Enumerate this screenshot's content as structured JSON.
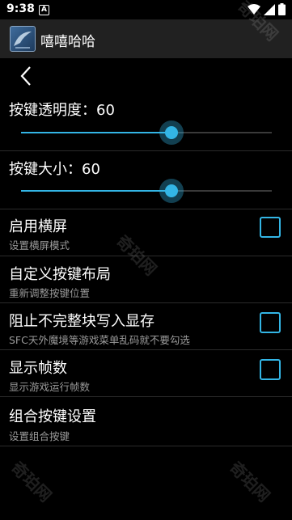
{
  "status_bar": {
    "time": "9:38",
    "notification_icon_letter": "A"
  },
  "app_bar": {
    "title": "嘻嘻哈哈",
    "icon": "app-logo-icon"
  },
  "sliders": [
    {
      "label": "按键透明度：60",
      "value": 60,
      "max": 100
    },
    {
      "label": "按键大小：60",
      "value": 60,
      "max": 100
    }
  ],
  "settings": [
    {
      "title": "启用横屏",
      "subtitle": "设置横屏模式",
      "checkbox": true,
      "checked": false
    },
    {
      "title": "自定义按键布局",
      "subtitle": "重新调整按键位置",
      "checkbox": false
    },
    {
      "title": "阻止不完整块写入显存",
      "subtitle": "SFC天外魔境等游戏菜单乱码就不要勾选",
      "checkbox": true,
      "checked": false
    },
    {
      "title": "显示帧数",
      "subtitle": "显示游戏运行帧数",
      "checkbox": true,
      "checked": false
    },
    {
      "title": "组合按键设置",
      "subtitle": "设置组合按键",
      "checkbox": false
    }
  ],
  "watermark": "奇珀网",
  "colors": {
    "accent": "#33b5e5",
    "app_bar": "#212121",
    "background": "#000000"
  }
}
